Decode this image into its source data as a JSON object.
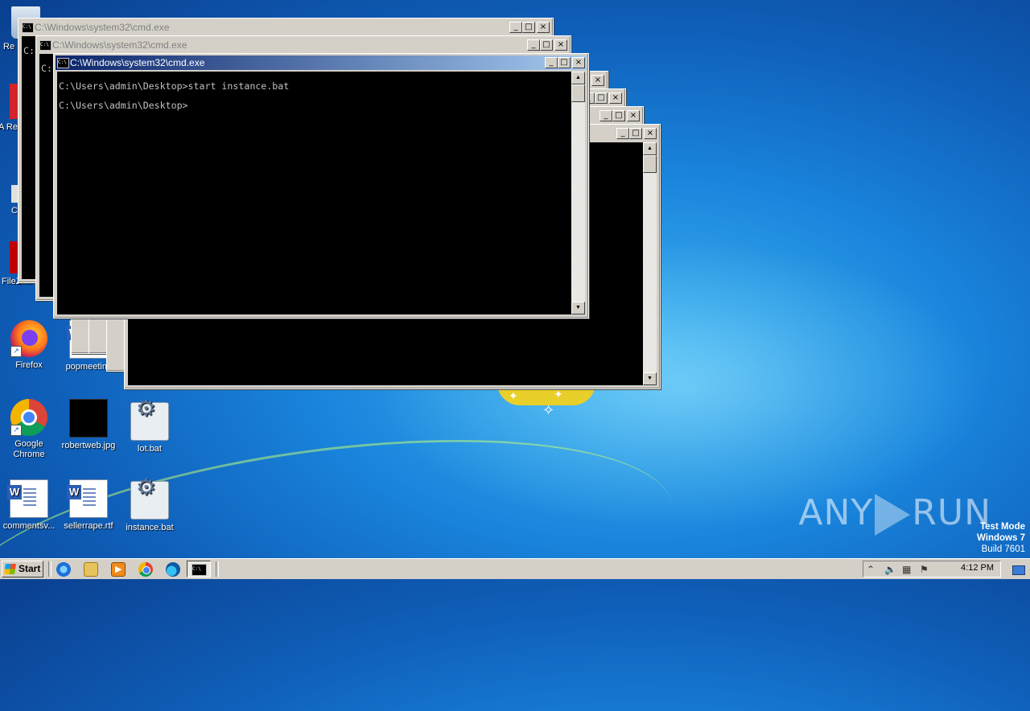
{
  "desktop": {
    "icons": {
      "recycle_label": "Re",
      "acrobat_label": "A Re",
      "ccleaner_label": "C",
      "filezilla_label": "FileZilla C",
      "firefox_label": "Firefox",
      "popmeeting_label": "popmeetinc",
      "chrome_label": "Google Chrome",
      "robertweb_label": "robertweb.jpg",
      "lot_label": "lot.bat",
      "commentsv_label": "commentsv...",
      "sellerrape_label": "sellerrape.rtf",
      "instance_label": "instance.bat"
    }
  },
  "windows": {
    "title": "C:\\Windows\\system32\\cmd.exe",
    "console_lines": [
      "C:\\Users\\admin\\Desktop>start instance.bat",
      "C:\\Users\\admin\\Desktop>"
    ],
    "side_lines": [
      "C:",
      "C:",
      "C:"
    ],
    "minimize_glyph": "_",
    "maximize_glyph": "□",
    "close_glyph": "×",
    "scroll_up": "▲",
    "scroll_down": "▼",
    "icon_text": "C:\\"
  },
  "taskbar": {
    "start_label": "Start",
    "clock": "4:12 PM"
  },
  "watermark": {
    "left": "ANY",
    "right": "RUN"
  },
  "os_info": {
    "line1": "Test Mode",
    "line2": "Windows 7",
    "line3": "Build 7601"
  },
  "colors": {
    "active_title_start": "#0a246a",
    "active_title_end": "#a6caf0",
    "console_bg": "#000000",
    "console_text": "#c0c0c0"
  }
}
